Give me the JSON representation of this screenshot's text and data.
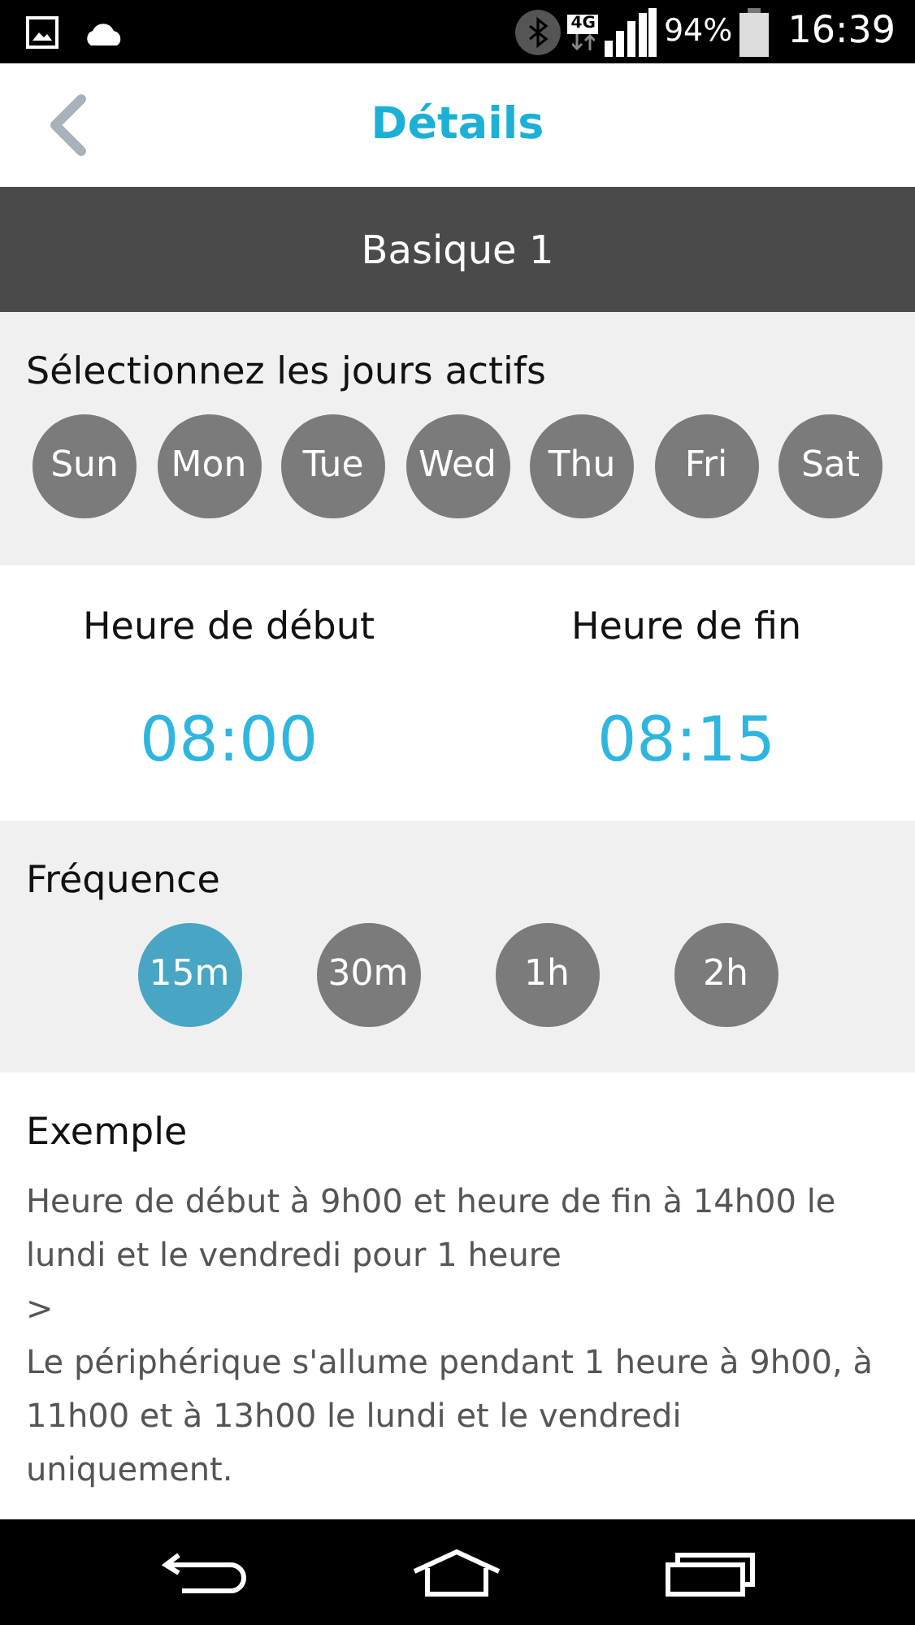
{
  "status_bar": {
    "network": "4G",
    "battery": "94%",
    "time": "16:39"
  },
  "header": {
    "title": "Détails"
  },
  "section_bar": {
    "title": "Basique 1"
  },
  "days": {
    "label": "Sélectionnez les jours actifs",
    "items": [
      {
        "label": "Sun",
        "selected": false
      },
      {
        "label": "Mon",
        "selected": false
      },
      {
        "label": "Tue",
        "selected": false
      },
      {
        "label": "Wed",
        "selected": false
      },
      {
        "label": "Thu",
        "selected": false
      },
      {
        "label": "Fri",
        "selected": false
      },
      {
        "label": "Sat",
        "selected": false
      }
    ]
  },
  "times": {
    "start": {
      "label": "Heure de début",
      "value": "08:00"
    },
    "end": {
      "label": "Heure de fin",
      "value": "08:15"
    }
  },
  "frequency": {
    "label": "Fréquence",
    "items": [
      {
        "label": "15m",
        "selected": true
      },
      {
        "label": "30m",
        "selected": false
      },
      {
        "label": "1h",
        "selected": false
      },
      {
        "label": "2h",
        "selected": false
      }
    ]
  },
  "example": {
    "title": "Exemple",
    "paragraphs": [
      "Heure de début à 9h00 et heure de fin à 14h00 le lundi et le vendredi pour 1 heure",
      ">",
      "Le périphérique s'allume pendant 1 heure à 9h00, à 11h00 et à 13h00 le lundi et le vendredi uniquement."
    ]
  }
}
